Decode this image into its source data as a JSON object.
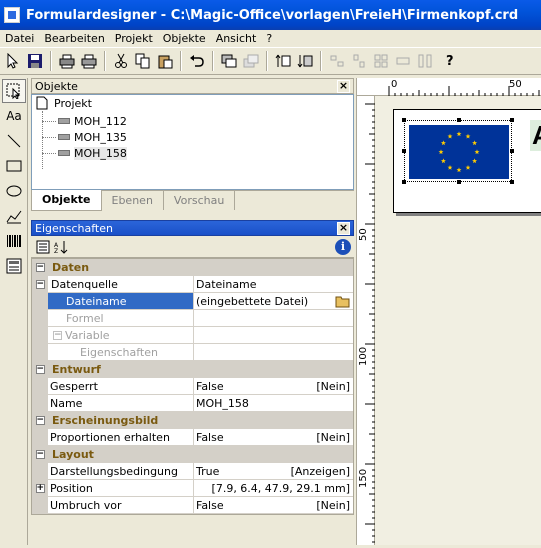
{
  "window": {
    "title": "Formulardesigner - C:\\Magic-Office\\vorlagen\\FreieH\\Firmenkopf.crd"
  },
  "menu": [
    "Datei",
    "Bearbeiten",
    "Projekt",
    "Objekte",
    "Ansicht",
    "?"
  ],
  "toolbar": {
    "help_label": "?"
  },
  "objects_panel": {
    "title": "Objekte",
    "tree_root": "Projekt",
    "items": [
      "MOH_112",
      "MOH_135",
      "MOH_158"
    ],
    "selected": "MOH_158"
  },
  "tabs": [
    "Objekte",
    "Ebenen",
    "Vorschau"
  ],
  "properties_panel": {
    "title": "Eigenschaften",
    "info_label": "i",
    "groups": {
      "daten": "Daten",
      "datenquelle": {
        "name": "Datenquelle",
        "value": "Dateiname"
      },
      "dateiname": {
        "name": "Dateiname",
        "value": "(eingebettete Datei)"
      },
      "formel": "Formel",
      "variable": "Variable",
      "eigenschaften": "Eigenschaften",
      "entwurf": "Entwurf",
      "gesperrt": {
        "name": "Gesperrt",
        "value": "False",
        "right": "[Nein]"
      },
      "name": {
        "name": "Name",
        "value": "MOH_158"
      },
      "erscheinungsbild": "Erscheinungsbild",
      "proportionen": {
        "name": "Proportionen erhalten",
        "value": "False",
        "right": "[Nein]"
      },
      "layout": "Layout",
      "darstellung": {
        "name": "Darstellungsbedingung",
        "value": "True",
        "right": "[Anzeigen]"
      },
      "position": {
        "name": "Position",
        "right": "[7.9, 6.4, 47.9, 29.1 mm]"
      },
      "umbruch": {
        "name": "Umbruch vor",
        "value": "False",
        "right": "[Nein]"
      }
    }
  },
  "ruler": {
    "top_labels": [
      "0",
      "50"
    ],
    "left_labels": [
      "50",
      "100",
      "150"
    ]
  },
  "canvas": {
    "text_fragment": "A"
  },
  "colors": {
    "title_blue": "#0153d9",
    "selection_blue": "#316ac5",
    "eu_blue": "#003399",
    "eu_star": "#ffcc00"
  }
}
